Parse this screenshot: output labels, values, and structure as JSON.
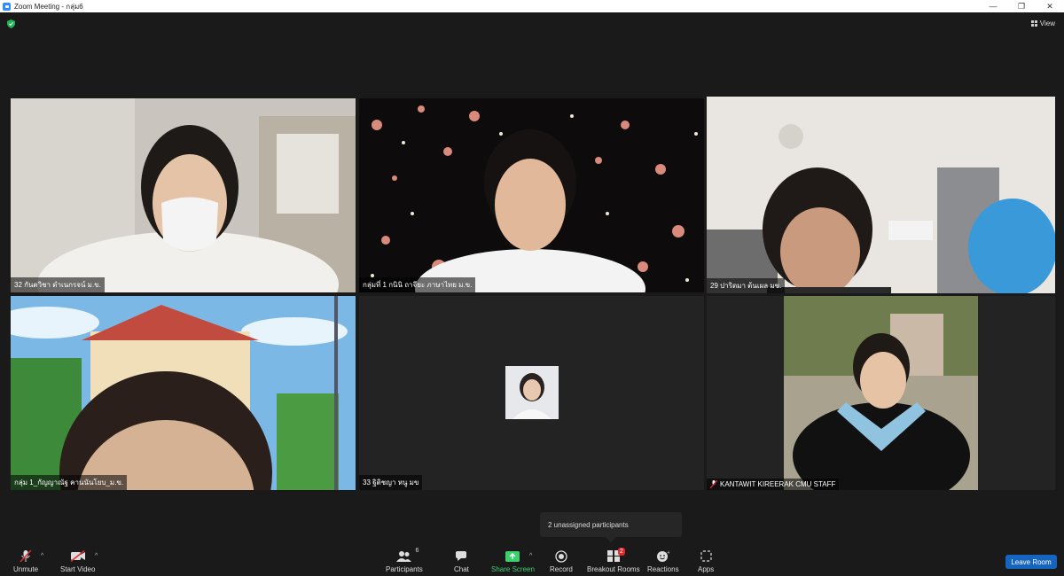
{
  "window": {
    "title": "Zoom Meeting - กลุ่ม6"
  },
  "header": {
    "view_label": "View"
  },
  "tiles": [
    {
      "name": "32 กันตวิชา ดำเนกรจน์ ม.ข."
    },
    {
      "name": "กลุ่มที่ 1 กนินิ ถาจียะ ภาษาไทย ม.ข."
    },
    {
      "name": "29 ปาริดมา ต้นเผล มข."
    },
    {
      "name": "กลุ่ม 1_กัญญาณัฐ คานนันโยบ_ม.ข."
    },
    {
      "name": "33 ฐิติชญา หนู มข"
    },
    {
      "name": "KANTAWIT KIREERAK CMU STAFF"
    }
  ],
  "tooltip": {
    "text": "2 unassigned participants"
  },
  "toolbar": {
    "unmute": "Unmute",
    "start_video": "Start Video",
    "participants": "Participants",
    "participants_count": "6",
    "chat": "Chat",
    "share_screen": "Share Screen",
    "record": "Record",
    "breakout_rooms": "Breakout Rooms",
    "breakout_badge": "2",
    "reactions": "Reactions",
    "apps": "Apps",
    "leave": "Leave Room"
  },
  "colors": {
    "accent": "#2d8cff",
    "share": "#3ecf6d",
    "leave": "#1565c0",
    "active_speaker": "#b6d86a"
  }
}
